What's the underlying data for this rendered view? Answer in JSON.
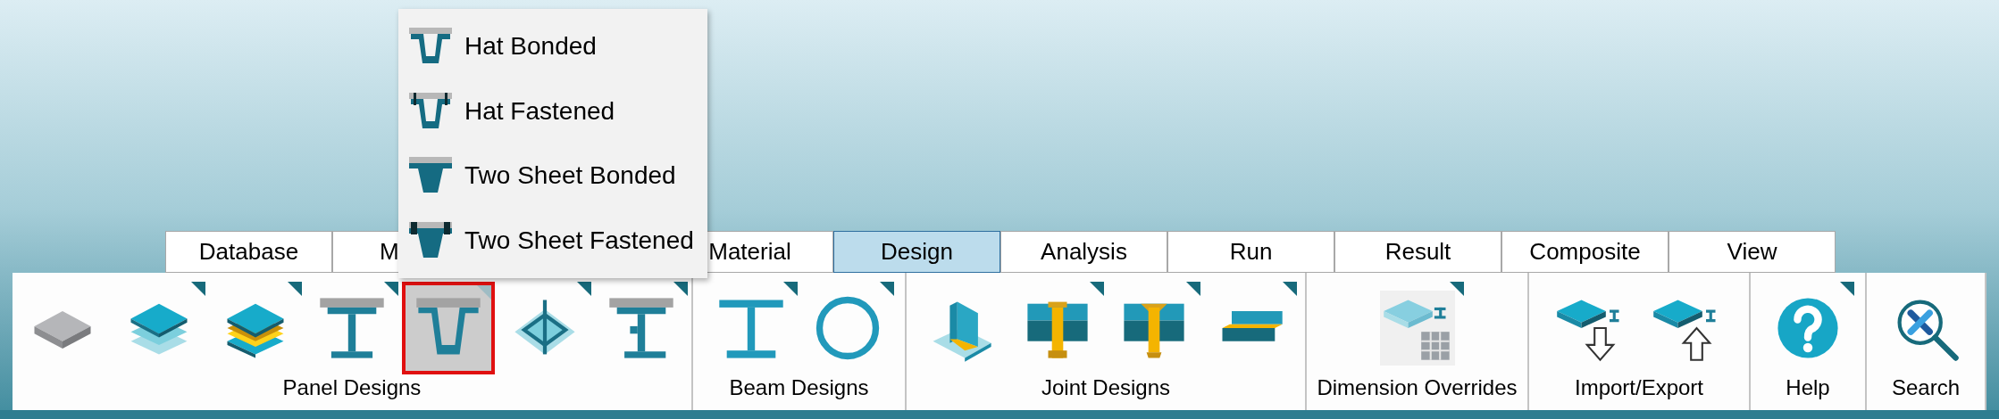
{
  "tabs": [
    {
      "label": "Database",
      "selected": false
    },
    {
      "label": "M",
      "selected": false,
      "cut": true
    },
    {
      "label": "Material",
      "selected": false
    },
    {
      "label": "Design",
      "selected": true
    },
    {
      "label": "Analysis",
      "selected": false
    },
    {
      "label": "Run",
      "selected": false
    },
    {
      "label": "Result",
      "selected": false
    },
    {
      "label": "Composite",
      "selected": false
    },
    {
      "label": "View",
      "selected": false
    }
  ],
  "ribbon_groups": [
    {
      "label": "Panel Designs",
      "buttons": [
        {
          "kind": "plate",
          "dropdown": false,
          "selected": false
        },
        {
          "kind": "layers",
          "dropdown": true,
          "selected": false
        },
        {
          "kind": "sandwich",
          "dropdown": true,
          "selected": false
        },
        {
          "kind": "capped-ibeam",
          "dropdown": true,
          "selected": false
        },
        {
          "kind": "hat",
          "dropdown": true,
          "selected": true
        },
        {
          "kind": "grid-frame",
          "dropdown": true,
          "selected": false
        },
        {
          "kind": "capped-jbeam",
          "dropdown": true,
          "selected": false
        }
      ]
    },
    {
      "label": "Beam Designs",
      "buttons": [
        {
          "kind": "ibeam",
          "dropdown": true,
          "selected": false
        },
        {
          "kind": "tube",
          "dropdown": true,
          "selected": false
        }
      ]
    },
    {
      "label": "Joint Designs",
      "buttons": [
        {
          "kind": "weld",
          "dropdown": false,
          "selected": false
        },
        {
          "kind": "bolt",
          "dropdown": true,
          "selected": false
        },
        {
          "kind": "rivet",
          "dropdown": true,
          "selected": false
        },
        {
          "kind": "lap",
          "dropdown": true,
          "selected": false
        }
      ]
    },
    {
      "label": "Dimension Overrides",
      "buttons": [
        {
          "kind": "dimension",
          "dropdown": true,
          "selected": false
        }
      ]
    },
    {
      "label": "Import/Export",
      "buttons": [
        {
          "kind": "import",
          "dropdown": false,
          "selected": false
        },
        {
          "kind": "export",
          "dropdown": false,
          "selected": false
        }
      ]
    },
    {
      "label": "Help",
      "buttons": [
        {
          "kind": "help",
          "dropdown": true,
          "selected": false
        }
      ]
    },
    {
      "label": "Search",
      "buttons": [
        {
          "kind": "search",
          "dropdown": false,
          "selected": false
        }
      ]
    }
  ],
  "dropdown_menu": {
    "items": [
      {
        "label": "Hat Bonded",
        "kind": "hat-bonded"
      },
      {
        "label": "Hat Fastened",
        "kind": "hat-fastened"
      },
      {
        "label": "Two Sheet Bonded",
        "kind": "two-sheet-bonded"
      },
      {
        "label": "Two Sheet Fastened",
        "kind": "two-sheet-fastened"
      }
    ]
  }
}
